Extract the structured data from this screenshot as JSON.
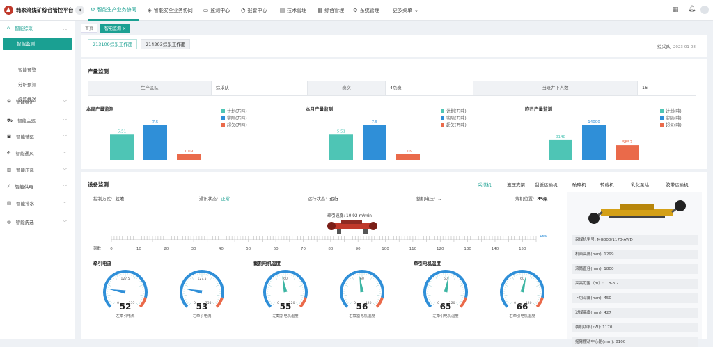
{
  "app": {
    "title": "韩家湾煤矿综合管控平台"
  },
  "topnav": [
    {
      "label": "智能生产业务协同",
      "icon": "factory-icon",
      "active": true
    },
    {
      "label": "智能安全业务协同",
      "icon": "shield-icon"
    },
    {
      "label": "监测中心",
      "icon": "monitor-icon"
    },
    {
      "label": "报警中心",
      "icon": "bell-icon"
    },
    {
      "label": "技术管理",
      "icon": "document-icon"
    },
    {
      "label": "综合管理",
      "icon": "grid-icon"
    },
    {
      "label": "系统管理",
      "icon": "gear-icon"
    },
    {
      "label": "更多菜单"
    }
  ],
  "sidebar": {
    "groups": [
      {
        "label": "智能综采",
        "icon": "mining-icon"
      },
      {
        "label": "智能掘进",
        "icon": "drill-icon"
      },
      {
        "label": "智能主运",
        "icon": "cart-icon"
      },
      {
        "label": "智能辅运",
        "icon": "truck-icon"
      },
      {
        "label": "智能通风",
        "icon": "fan-icon"
      },
      {
        "label": "智能压风",
        "icon": "compressor-icon"
      },
      {
        "label": "智能供电",
        "icon": "power-icon"
      },
      {
        "label": "智能排水",
        "icon": "drain-icon"
      },
      {
        "label": "智能洗选",
        "icon": "wash-icon"
      }
    ],
    "subitems": [
      {
        "label": "智能监测",
        "active": true
      },
      {
        "label": "智能预警"
      },
      {
        "label": "分析预测"
      },
      {
        "label": "报警推送"
      }
    ]
  },
  "breadcrumb": {
    "home": "首页",
    "current": "智能监测"
  },
  "work_tabs": [
    "213109综采工作面",
    "214203综采工作面"
  ],
  "header_right": {
    "team": "综采队",
    "date": "2023-01-08"
  },
  "production": {
    "title": "产量监测",
    "info": {
      "area_label": "生产区队",
      "area_value": "综采队",
      "shift_label": "班次",
      "shift_value": "4点班",
      "people_label": "当班井下人数",
      "people_value": "16"
    }
  },
  "chart_data": [
    {
      "type": "bar",
      "title": "本周产量监测",
      "categories": [
        "计划(万吨)",
        "实际(万吨)",
        "超欠(万吨)"
      ],
      "values": [
        5.51,
        7.5,
        1.09
      ],
      "colors": [
        "#4ec5b5",
        "#2f8fd8",
        "#ea6a4a"
      ]
    },
    {
      "type": "bar",
      "title": "本月产量监测",
      "categories": [
        "计划(万吨)",
        "实际(万吨)",
        "超欠(万吨)"
      ],
      "values": [
        5.51,
        7.5,
        1.09
      ],
      "colors": [
        "#4ec5b5",
        "#2f8fd8",
        "#ea6a4a"
      ]
    },
    {
      "type": "bar",
      "title": "昨日产量监测",
      "categories": [
        "计划(吨)",
        "实际(吨)",
        "超欠(吨)"
      ],
      "values": [
        8148,
        14000,
        5852
      ],
      "colors": [
        "#4ec5b5",
        "#2f8fd8",
        "#ea6a4a"
      ]
    }
  ],
  "device": {
    "title": "设备监测",
    "tabs": [
      "采煤机",
      "液压支架",
      "刮板运输机",
      "破碎机",
      "转载机",
      "乳化泵站",
      "胶带运输机"
    ],
    "status": {
      "control_label": "控制方式:",
      "control_value": "就地",
      "comm_label": "通讯状态:",
      "comm_value": "正常",
      "run_label": "运行状态:",
      "run_value": "运行",
      "volt_label": "整机电压:",
      "volt_value": "--",
      "pos_label": "煤机位置:",
      "pos_value": "85架"
    },
    "speed_label": "牵引速度:",
    "speed_value": "10.92 m/min",
    "scale": {
      "label": "架数",
      "ticks": [
        0,
        10,
        20,
        30,
        40,
        50,
        60,
        70,
        80,
        90,
        100,
        110,
        120,
        130,
        140,
        150
      ],
      "end": "155"
    },
    "gauge_groups": [
      "牵引电流",
      "截割电机温度",
      "牵引电机温度"
    ],
    "gauges": [
      {
        "value": 52,
        "min": 0,
        "max": 255,
        "mid": "127.5",
        "label": "左牵引电流"
      },
      {
        "value": 53,
        "min": 0,
        "max": 255,
        "mid": "127.5",
        "label": "右牵引电流"
      },
      {
        "value": 55,
        "min": 0,
        "max": 120,
        "mid": "60",
        "label": "左截割电机温度"
      },
      {
        "value": 56,
        "min": 0,
        "max": 120,
        "mid": "60",
        "label": "右截割电机温度"
      },
      {
        "value": 65,
        "min": 0,
        "max": 120,
        "mid": "60",
        "label": "左牵引电机温度"
      },
      {
        "value": 66,
        "min": 0,
        "max": 120,
        "mid": "60",
        "label": "右牵引电机温度"
      }
    ],
    "specs": [
      "采煤机型号: MG800/1170-AWD",
      "机面高度(mm): 1299",
      "滚筒直径(mm): 1800",
      "采高范围（m）: 1.8-3.2",
      "下切深度(mm): 450",
      "过煤高度(mm): 427",
      "装机功率(kW): 1170",
      "摇臂摆动中心距(mm): 8100"
    ]
  }
}
